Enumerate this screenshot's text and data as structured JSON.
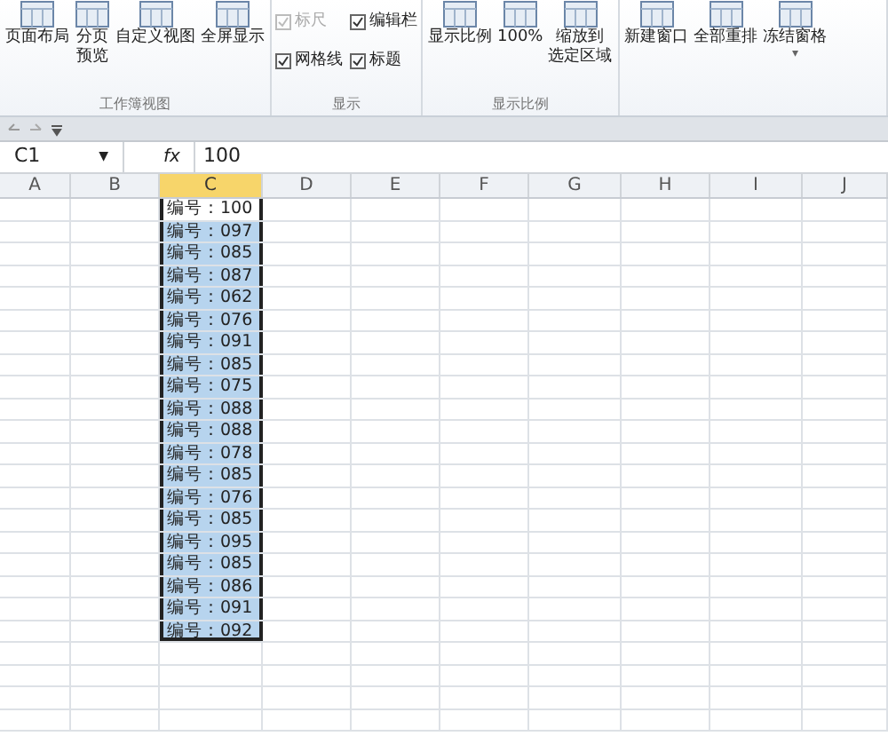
{
  "ribbon": {
    "groups": [
      {
        "kind": "buttons",
        "label": "工作簿视图",
        "buttons": [
          {
            "label": "页面布局"
          },
          {
            "lines": [
              "分页",
              "预览"
            ]
          },
          {
            "label": "自定义视图"
          },
          {
            "label": "全屏显示"
          }
        ]
      },
      {
        "kind": "checks",
        "label": "显示",
        "checks": [
          {
            "label": "标尺",
            "checked": true,
            "disabled": true
          },
          {
            "label": "编辑栏",
            "checked": true,
            "disabled": false
          },
          {
            "label": "网格线",
            "checked": true,
            "disabled": false
          },
          {
            "label": "标题",
            "checked": true,
            "disabled": false
          }
        ]
      },
      {
        "kind": "buttons",
        "label": "显示比例",
        "buttons": [
          {
            "label": "显示比例"
          },
          {
            "label": "100%"
          },
          {
            "lines": [
              "缩放到",
              "选定区域"
            ]
          }
        ]
      },
      {
        "kind": "buttons",
        "buttons": [
          {
            "label": "新建窗口"
          },
          {
            "label": "全部重排"
          },
          {
            "label": "冻结窗格",
            "dropdown": "▾"
          }
        ]
      }
    ]
  },
  "formula_bar": {
    "name_box": "C1",
    "name_box_dropdown": "▼",
    "function_label": "fx",
    "value": "100"
  },
  "sheet": {
    "columns": [
      {
        "label": "A",
        "selected": false
      },
      {
        "label": "B",
        "selected": false
      },
      {
        "label": "C",
        "selected": true
      },
      {
        "label": "D",
        "selected": false
      },
      {
        "label": "E",
        "selected": false
      },
      {
        "label": "F",
        "selected": false
      },
      {
        "label": "G",
        "selected": false
      },
      {
        "label": "H",
        "selected": false
      },
      {
        "label": "I",
        "selected": false
      },
      {
        "label": "J",
        "selected": false
      }
    ],
    "cells": [
      "编号：100",
      "编号：097",
      "编号：085",
      "编号：087",
      "编号：062",
      "编号：076",
      "编号：091",
      "编号：085",
      "编号：075",
      "编号：088",
      "编号：088",
      "编号：078",
      "编号：085",
      "编号：076",
      "编号：085",
      "编号：095",
      "编号：085",
      "编号：086",
      "编号：091",
      "编号：092"
    ]
  }
}
